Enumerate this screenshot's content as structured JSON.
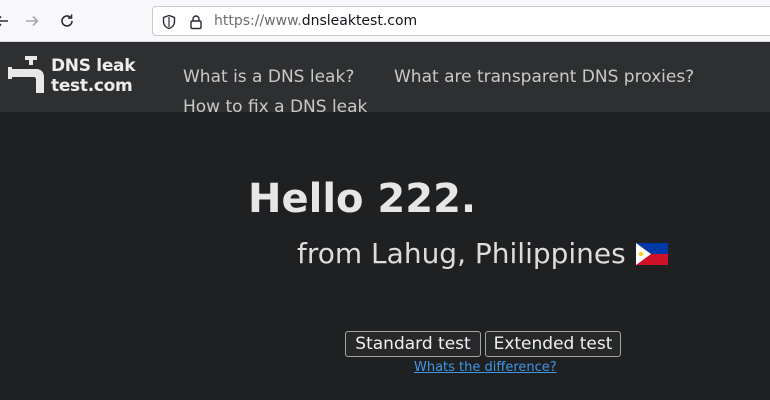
{
  "browser": {
    "url_prefix": "https://www.",
    "url_domain": "dnsleaktest.com"
  },
  "header": {
    "logo_line1": "DNS leak",
    "logo_line2": "test.com",
    "nav": [
      {
        "label": "What is a DNS leak?"
      },
      {
        "label": "What are transparent DNS proxies?"
      },
      {
        "label": "How to fix a DNS leak"
      }
    ]
  },
  "main": {
    "greeting": "Hello 222.",
    "location": "from Lahug, Philippines",
    "flag_icon": "philippines-flag-icon",
    "standard_test_label": "Standard test",
    "extended_test_label": "Extended test",
    "difference_link": "Whats the difference?"
  },
  "colors": {
    "background": "#1f2022",
    "header": "#2d2f31",
    "link": "#3f96e6"
  }
}
